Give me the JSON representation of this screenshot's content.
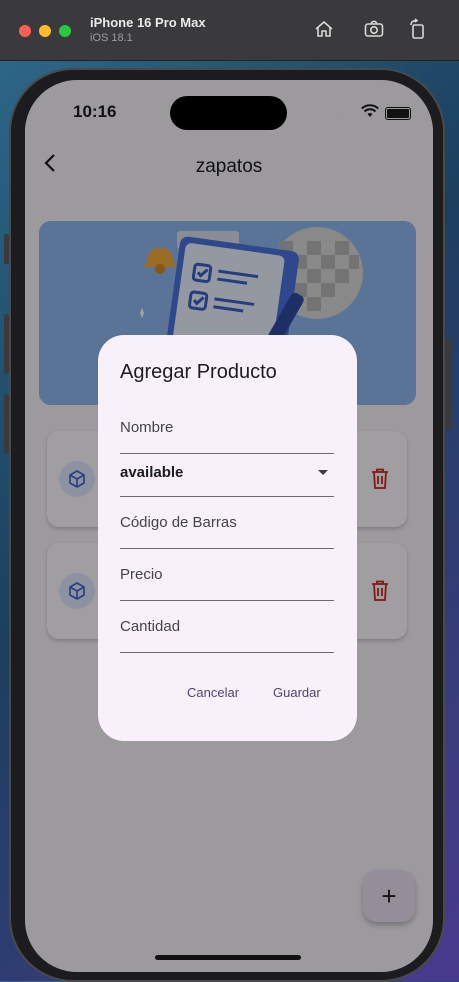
{
  "simulator": {
    "device_name": "iPhone 16 Pro Max",
    "os_version": "iOS 18.1",
    "icons": [
      "home-icon",
      "screenshot-icon",
      "rotate-icon"
    ]
  },
  "status_bar": {
    "time": "10:16",
    "signal": "••••"
  },
  "app_bar": {
    "title": "zapatos",
    "back_icon": "chevron-left-icon"
  },
  "products": [
    {
      "icon": "cube-icon",
      "delete_icon": "trash-icon"
    },
    {
      "icon": "cube-icon",
      "delete_icon": "trash-icon"
    }
  ],
  "fab": {
    "label": "+"
  },
  "dialog": {
    "title": "Agregar Producto",
    "fields": {
      "name_label": "Nombre",
      "status_value": "available",
      "barcode_label": "Código de Barras",
      "price_label": "Precio",
      "quantity_label": "Cantidad"
    },
    "cancel_label": "Cancelar",
    "save_label": "Guardar"
  },
  "colors": {
    "accent": "#4f4570",
    "delete": "#c62828",
    "dialog_bg": "#f8f1fa"
  }
}
